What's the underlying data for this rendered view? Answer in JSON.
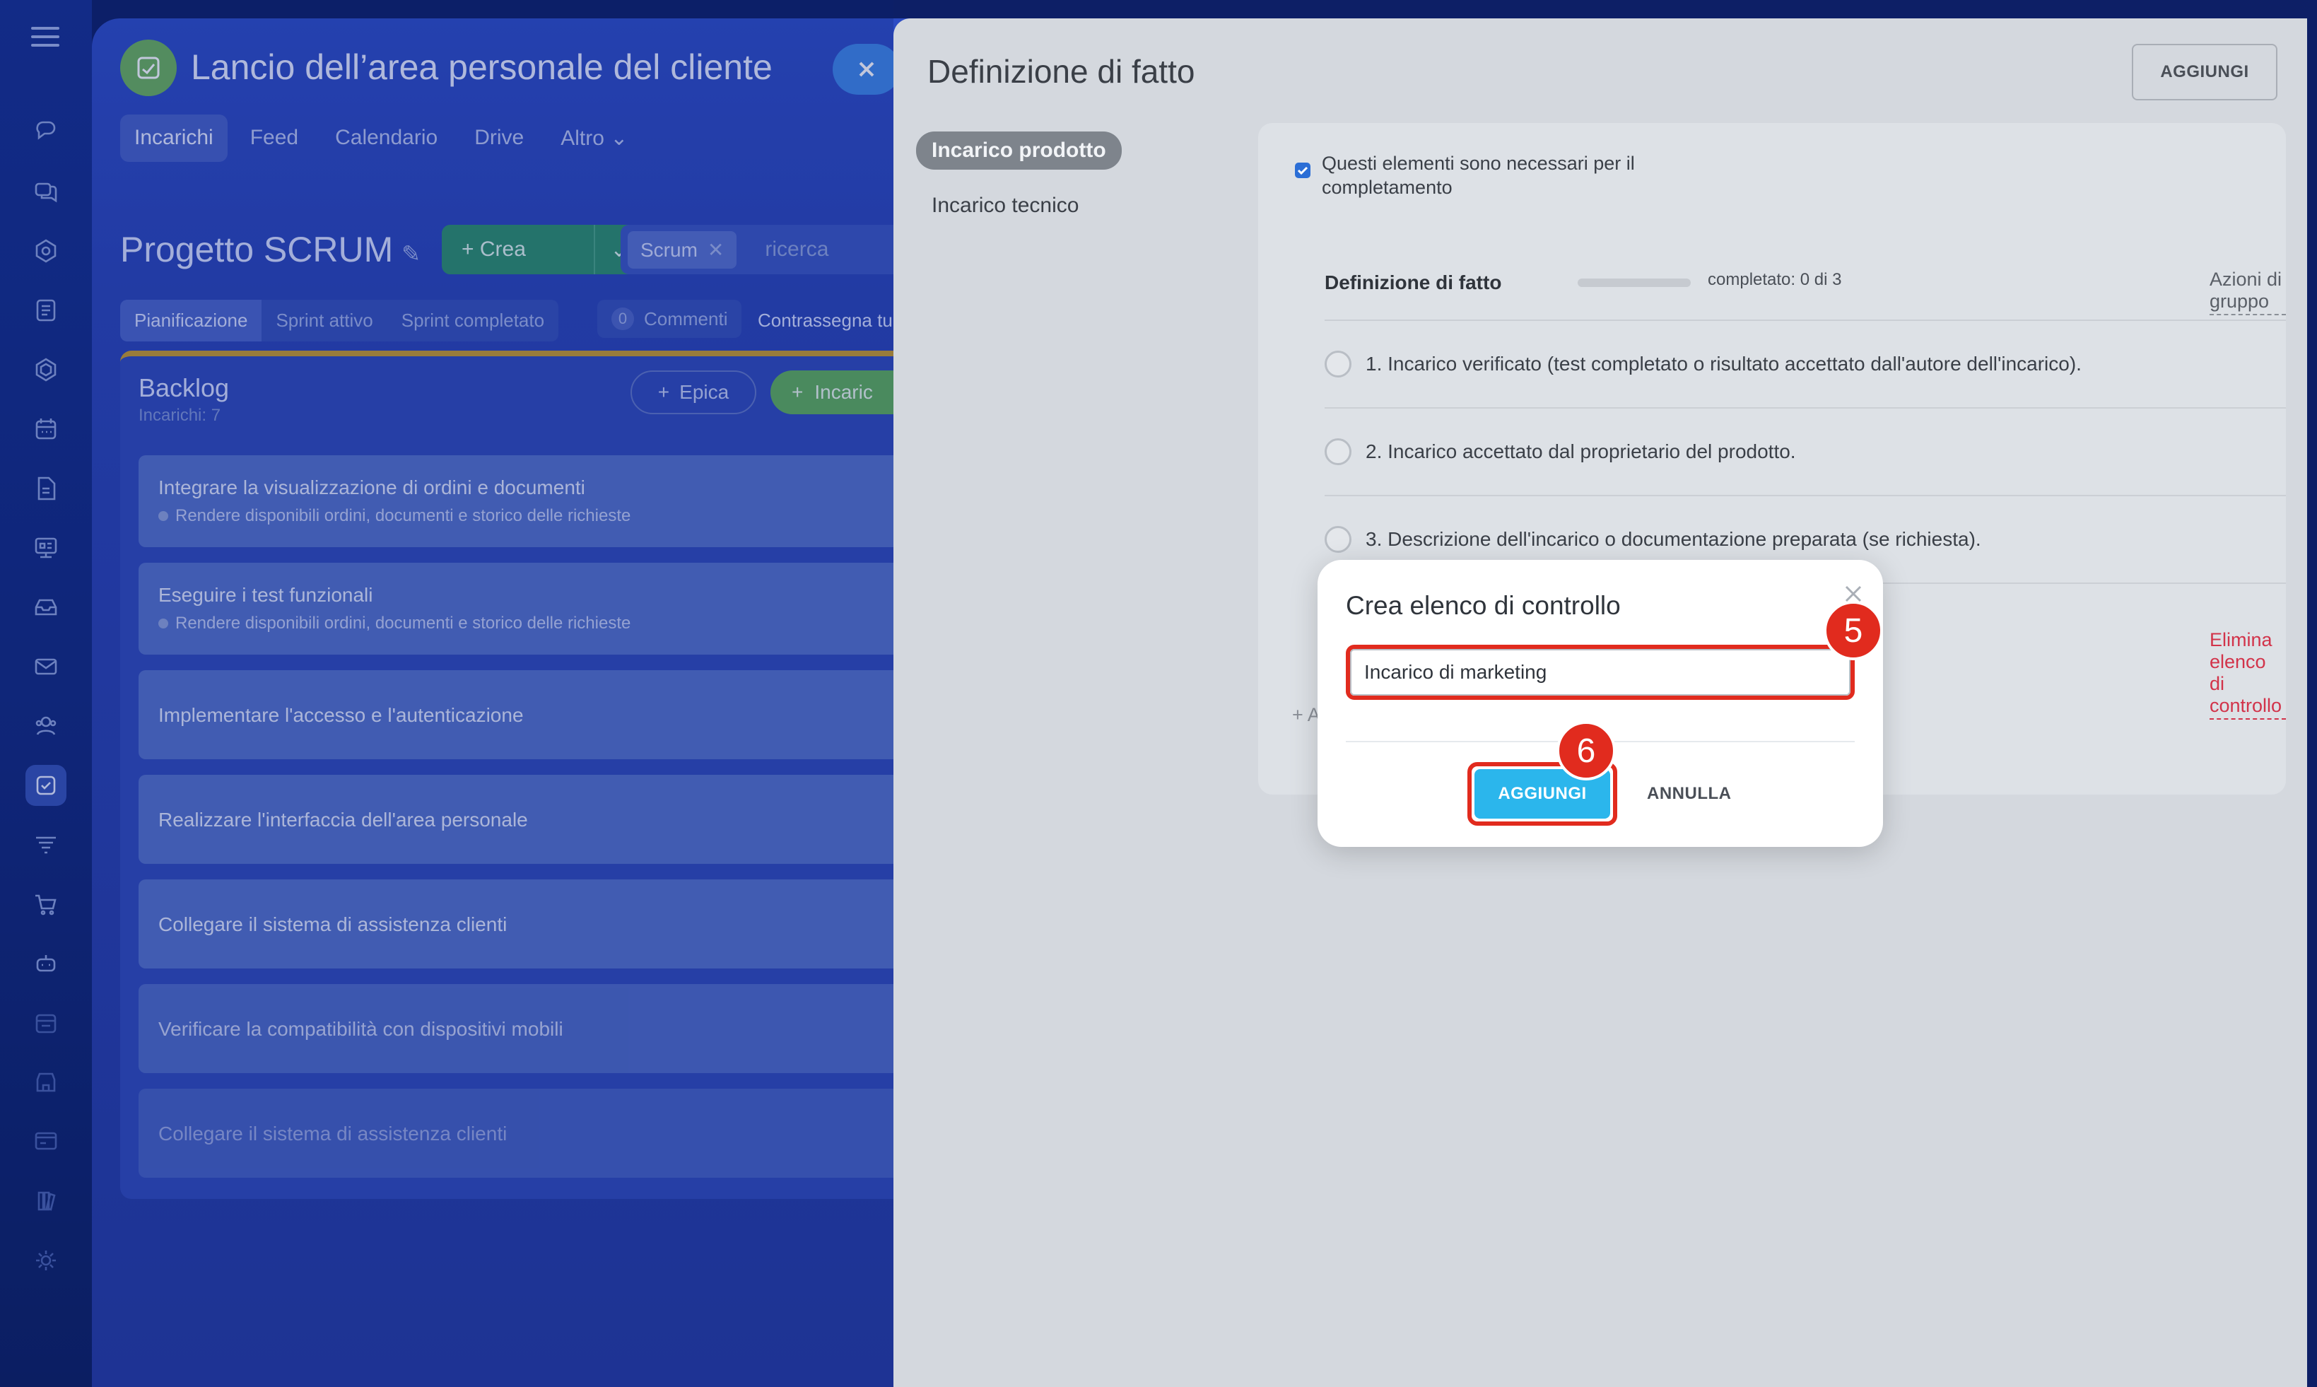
{
  "background_app": {
    "project_title": "Lancio dell’area personale del cliente",
    "tabs": [
      "Incarichi",
      "Feed",
      "Calendario",
      "Drive",
      "Altro ⌄"
    ],
    "scrum_title": "Progetto SCRUM",
    "create_label": "+ Crea",
    "search_chip": "Scrum",
    "search_placeholder": "ricerca",
    "subtabs": [
      "Pianificazione",
      "Sprint attivo",
      "Sprint completato"
    ],
    "comments_count": "0",
    "comments_label": "Commenti",
    "mark_all": "Contrassegna tu",
    "backlog_title": "Backlog",
    "backlog_sub": "Incarichi: 7",
    "epic_label": "Epica",
    "task_label": "Incaric",
    "tasks": [
      {
        "title": "Integrare la visualizzazione di ordini e documenti",
        "subtitle": "Rendere disponibili ordini, documenti e storico delle richieste"
      },
      {
        "title": "Eseguire i test funzionali",
        "subtitle": "Rendere disponibili ordini, documenti e storico delle richieste"
      },
      {
        "title": "Implementare l'accesso e l'autenticazione",
        "subtitle": ""
      },
      {
        "title": "Realizzare l'interfaccia dell'area personale",
        "subtitle": ""
      },
      {
        "title": "Collegare il sistema di assistenza clienti",
        "subtitle": ""
      },
      {
        "title": "Verificare la compatibilità con dispositivi mobili",
        "subtitle": ""
      },
      {
        "title": "Collegare il sistema di assistenza clienti",
        "subtitle": ""
      }
    ]
  },
  "panel": {
    "title": "Definizione di fatto",
    "add_button": "AGGIUNGI",
    "side_items": [
      "Incarico prodotto",
      "Incarico tecnico"
    ],
    "required_text": "Questi elementi sono necessari per il completamento",
    "checklist_title": "Definizione di fatto",
    "progress_text": "completato: 0 di 3",
    "progress_fraction": 0,
    "group_actions": "Azioni di gruppo",
    "items": [
      "1. Incarico verificato (test completato o risultato accettato dall'autore dell'incarico).",
      "2. Incarico accettato dal proprietario del prodotto.",
      "3. Descrizione dell'incarico o documentazione preparata (se richiesta)."
    ],
    "delete_checklist": "Elimina elenco di controllo",
    "add_item": "+ A"
  },
  "modal": {
    "title": "Crea elenco di controllo",
    "input_value": "Incarico di marketing",
    "add_button": "AGGIUNGI",
    "cancel_button": "ANNULLA"
  },
  "annotations": {
    "step_input": "5",
    "step_add": "6",
    "highlight_color": "#e12b1e"
  },
  "colors": {
    "accent_blue": "#2bb6ec",
    "checkbox_blue": "#2b6ed6",
    "delete_red": "#d2334a"
  }
}
